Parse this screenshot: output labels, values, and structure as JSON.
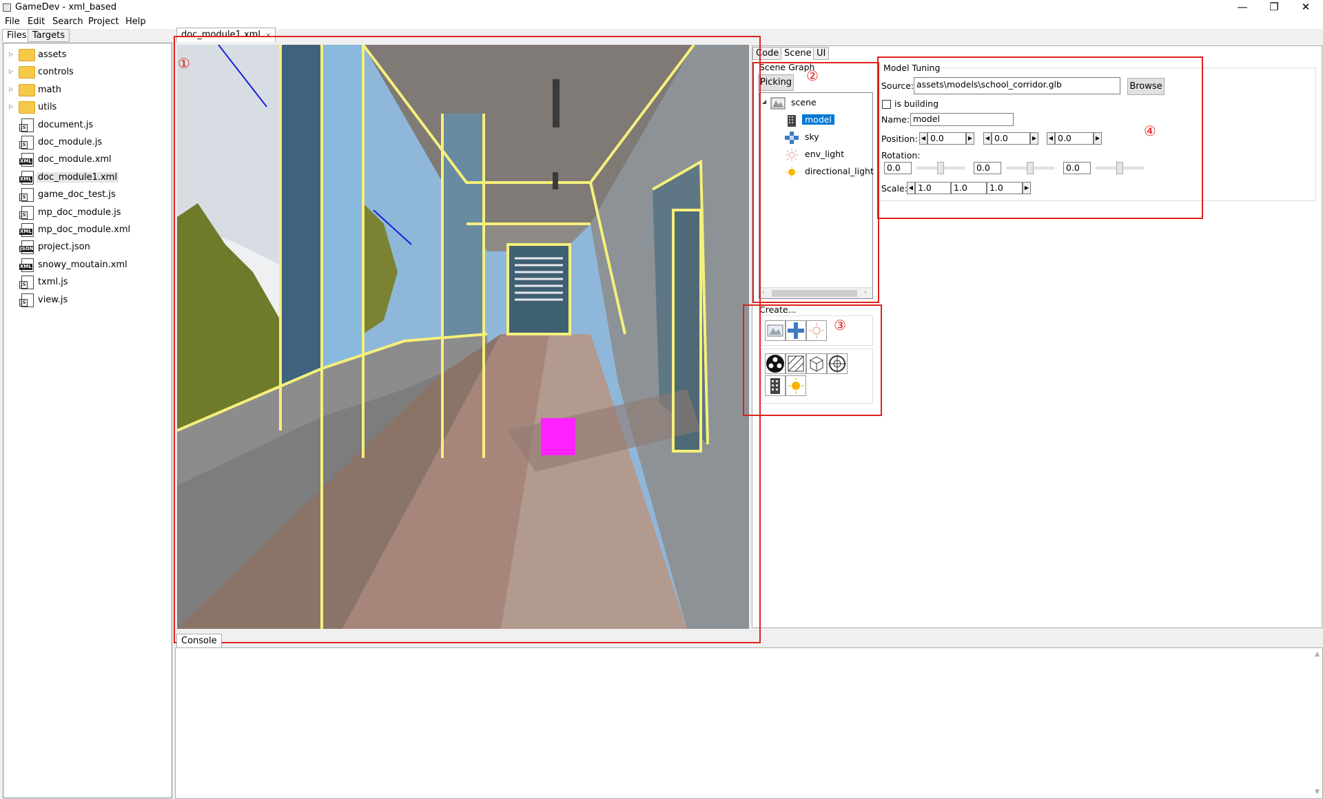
{
  "window": {
    "title": "GameDev - xml_based",
    "minimize": "—",
    "restore": "❐",
    "close": "✕"
  },
  "menu": [
    "File",
    "Edit",
    "Search",
    "Project",
    "Help"
  ],
  "left_tabs": [
    "Files",
    "Targets"
  ],
  "file_tree": [
    {
      "label": "assets",
      "kind": "folder"
    },
    {
      "label": "controls",
      "kind": "folder"
    },
    {
      "label": "math",
      "kind": "folder"
    },
    {
      "label": "utils",
      "kind": "folder"
    },
    {
      "label": "document.js",
      "kind": "js"
    },
    {
      "label": "doc_module.js",
      "kind": "js"
    },
    {
      "label": "doc_module.xml",
      "kind": "xml"
    },
    {
      "label": "doc_module1.xml",
      "kind": "xml",
      "selected": true
    },
    {
      "label": "game_doc_test.js",
      "kind": "js"
    },
    {
      "label": "mp_doc_module.js",
      "kind": "js"
    },
    {
      "label": "mp_doc_module.xml",
      "kind": "xml"
    },
    {
      "label": "project.json",
      "kind": "json"
    },
    {
      "label": "snowy_moutain.xml",
      "kind": "xml"
    },
    {
      "label": "txml.js",
      "kind": "js"
    },
    {
      "label": "view.js",
      "kind": "js"
    }
  ],
  "icon_text": {
    "xml": "XML",
    "js": "JS",
    "json": "JSON"
  },
  "doc_tab": {
    "label": "doc_module1.xml",
    "close": "×"
  },
  "right_tabs": [
    "Code",
    "Scene",
    "UI"
  ],
  "scene_graph": {
    "title": "Scene Graph",
    "picking_button": "Picking",
    "items": [
      {
        "label": "scene",
        "icon": "scene-icon",
        "expanded": true
      },
      {
        "label": "model",
        "icon": "building-icon",
        "selected": true
      },
      {
        "label": "sky",
        "icon": "sky-icon"
      },
      {
        "label": "env_light",
        "icon": "env-light-icon"
      },
      {
        "label": "directional_light",
        "icon": "sun-icon"
      }
    ]
  },
  "create": {
    "title": "Create..."
  },
  "model_tuning": {
    "title": "Model Tuning",
    "source_label": "Source:",
    "source_value": "assets\\models\\school_corridor.glb",
    "browse_button": "Browse",
    "is_building_label": "is building",
    "is_building_checked": false,
    "name_label": "Name:",
    "name_value": "model",
    "position_label": "Position:",
    "position": [
      "0.0",
      "0.0",
      "0.0"
    ],
    "rotation_label": "Rotation:",
    "rotation": [
      "0.0",
      "0.0",
      "0.0"
    ],
    "scale_label": "Scale:",
    "scale": [
      "1.0",
      "1.0",
      "1.0"
    ]
  },
  "annotations": [
    "①",
    "②",
    "③",
    "④"
  ],
  "console_tab": "Console",
  "colors": {
    "accent": "#0078d7",
    "annotation_red": "#e0201c",
    "highlight_yellow": "#f5f07a",
    "magenta_marker": "#ff22ff"
  }
}
